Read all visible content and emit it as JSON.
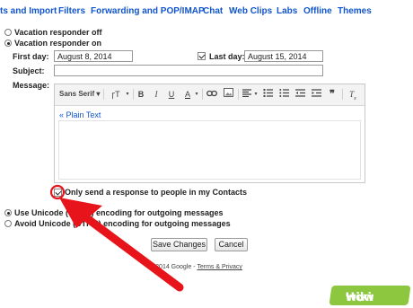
{
  "tabs": [
    {
      "label": "ts and Import"
    },
    {
      "label": "Filters"
    },
    {
      "label": "Forwarding and POP/IMAP"
    },
    {
      "label": "Chat"
    },
    {
      "label": "Web Clips"
    },
    {
      "label": "Labs"
    },
    {
      "label": "Offline"
    },
    {
      "label": "Themes"
    }
  ],
  "vacation": {
    "off_label": "Vacation responder off",
    "on_label": "Vacation responder on",
    "selected": "on",
    "first_day_label": "First day:",
    "first_day_value": "August 8, 2014",
    "last_day_checked": true,
    "last_day_label": "Last day:",
    "last_day_value": "August 15, 2014",
    "subject_label": "Subject:",
    "subject_value": "",
    "message_label": "Message:"
  },
  "toolbar": {
    "font": "Sans Serif",
    "font_dropdown": "▾",
    "size_icon": "ꞅT",
    "bold": "B",
    "italic": "I",
    "underline": "U",
    "text_color": "A",
    "plain_text_link": "« Plain Text"
  },
  "contacts_only": {
    "checked": true,
    "label": "Only send a response to people in my Contacts"
  },
  "encoding": {
    "use_label": "Use Unicode (UTF-8) encoding for outgoing messages",
    "avoid_label": "Avoid Unicode (UTF-8) encoding for outgoing messages",
    "selected": "use"
  },
  "buttons": {
    "save": "Save Changes",
    "cancel": "Cancel"
  },
  "footer": {
    "copyright": "©2014 Google -",
    "terms": "Terms & Privacy"
  },
  "watermark": {
    "wiki": "wiki",
    "how": "How"
  },
  "colors": {
    "link": "#1155cc",
    "arrow": "#e8141b",
    "watermark": "#8dc63f"
  }
}
